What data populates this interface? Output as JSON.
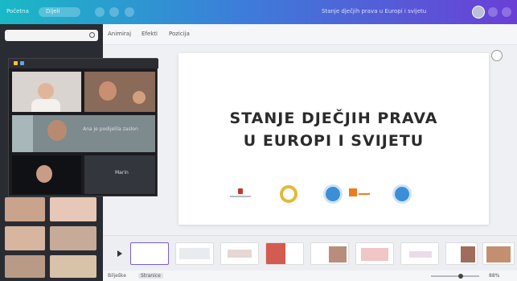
{
  "topbar": {
    "home_label": "Početna",
    "share_label": "Dijeli",
    "doc_title": "Stanje dječjih prava u Europi i svijetu"
  },
  "toolbar": {
    "animate_label": "Animiraj",
    "effects_label": "Efekti",
    "position_label": "Pozicija"
  },
  "slide": {
    "title_line1": "STANJE DJEČJIH PRAVA",
    "title_line2": "U EUROPI I SVIJETU"
  },
  "call": {
    "participant_label": "Marin",
    "banner": "Ana je podijelila zaslon"
  },
  "bottombar": {
    "notes_label": "Bilješke",
    "pages_label": "Stranice",
    "zoom": "88%"
  },
  "colors": {
    "accent": "#3b7fd9",
    "brand_teal": "#19b9c6",
    "title": "#2b2b2b"
  }
}
